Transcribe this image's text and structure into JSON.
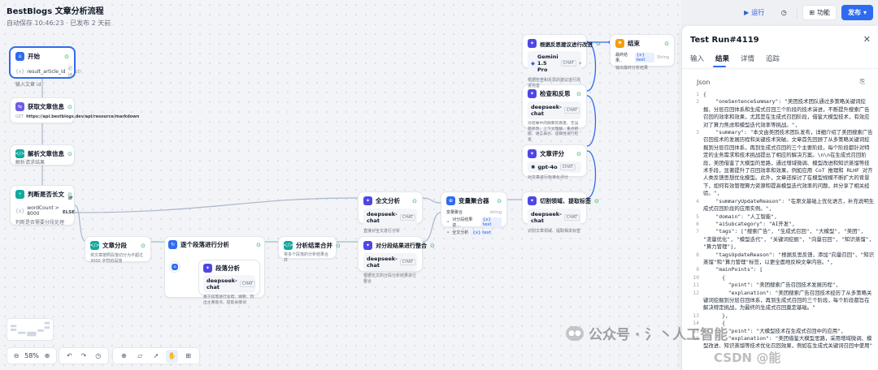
{
  "app": {
    "title": "BestBlogs 文章分析流程",
    "autosave": "自动保存 10:46:23 · 已发布 2 天前"
  },
  "toolbar": {
    "run_label": "运行",
    "feature_label": "功能",
    "publish_label": "发布"
  },
  "nodes": {
    "start": {
      "title": "开始",
      "var_name": "result_article_id",
      "var_badge": "必填",
      "var_type": "str",
      "desc": "输入文章 id"
    },
    "fetch": {
      "title": "获取文章信息",
      "method": "GET",
      "url": "https://api.bestblogs.dev/api/resource/markdown"
    },
    "parse": {
      "title": "解析文章信息",
      "desc": "解析请求结果"
    },
    "branch": {
      "title": "判断是否长文",
      "if_label": "IF",
      "condition": "wordCount > 8000",
      "else_label": "ELSE",
      "desc": "判断是否需要分段处理"
    },
    "split": {
      "title": "文章分段",
      "desc": "将文章按照段落切分为不超过 3000 字符的段落"
    },
    "iterate": {
      "title": "逐个段落进行分析"
    },
    "segment": {
      "title": "段落分析",
      "model": "deepseek-chat",
      "model_tag": "CHAT",
      "desc": "基于段落进行总结、摘要、列出主要观点、提取关键词"
    },
    "merge_result": {
      "title": "分析结果合并",
      "desc": "将多个段落的分析结果合并"
    },
    "full_analysis": {
      "title": "全文分析",
      "model": "deepseek-chat",
      "model_tag": "CHAT",
      "desc": "直接对全文进行分析"
    },
    "summarize": {
      "title": "对分段结果进行整合",
      "model": "deepseek-chat",
      "model_tag": "CHAT",
      "desc": "根据长文的分段分析结果进行整合"
    },
    "aggregate": {
      "title": "变量聚合器",
      "group_label": "变量聚合",
      "group_type": "string",
      "item1_label": "对分段结果进...",
      "item1_chip": "{x} text",
      "item2_label": "全文分析",
      "item2_chip": "{x} text"
    },
    "domain": {
      "title": "切割领域、提取标签",
      "model": "deepseek-chat",
      "model_tag": "CHAT",
      "desc": "识别文章领域、提取相关标签"
    },
    "score": {
      "title": "文章评分",
      "model": "gpt-4o",
      "model_tag": "CHAT",
      "desc": "对文章进行标准化评分"
    },
    "reflect": {
      "title": "检查和反思",
      "model": "deepseek-chat",
      "model_tag": "CHAT",
      "desc": "对结果中的摘要的质量、无误差修改、上下文理解、重点把握、语言表达、逻辑性进行检查"
    },
    "improve": {
      "title": "根据反思建议进行改进",
      "model": "Gemini 1.5 Pro",
      "model_tag": "CHAT",
      "desc": "根据检查和反思的建议进行改进完善"
    },
    "end": {
      "title": "结束",
      "var_label": "最终结果..",
      "var_chip": "{x} text",
      "var_type": "String",
      "desc": "输出最终分析结果"
    }
  },
  "panel": {
    "title": "Test Run#4119",
    "tabs": [
      "输入",
      "结果",
      "详情",
      "追踪"
    ],
    "active_tab": "结果",
    "section_label": "Json",
    "code_lines": [
      {
        "n": "1",
        "t": "{"
      },
      {
        "n": "2",
        "t": "    \"oneSentenceSummary\": \"美团技术团队通过多策略关键词挖掘、分层召回体系和生成式召回三个阶段的技术演进，不断提升搜索广告召回的效率和效果，尤其是在生成式召回阶段，借鉴大模型技术，有效应对了算力焦虑和模型迭代效率等挑战。\","
      },
      {
        "n": "3",
        "t": "    \"summary\": \"本文由美团技术团队发布，详细介绍了美团搜索广告召回技术的发展历程和关键技术突破。文章首先回顾了从多策略关键词挖掘到分层召回体系，再到生成式召回的三个主要阶段，每个阶段都针对特定的业务需求和技术挑战提出了相应的解决方案。\\n\\n在生成式召回阶段，美团借鉴了大模型的思路，通过增域微调、模型改进和知识蒸馏等技术手段，显著提升了召回效率和效果，例如应用 CoT 推理和 RLHF 对齐人类反馈思想优化模型。此外，文章还探讨了在模型规模不断扩大的背景下，如何有效管理算力资源和提高模型迭代效率的问题，并分享了相关经验。\","
      },
      {
        "n": "4",
        "t": "    \"summaryUpdateReason\": \"在原文基础上优化语言，补充说明生成式召回阶段的应用实例。\","
      },
      {
        "n": "5",
        "t": "    \"domain\": \"人工智能\","
      },
      {
        "n": "6",
        "t": "    \"aiSubcategory\": \"AI开发\","
      },
      {
        "n": "7",
        "t": "    \"tags\": [\"搜索广告\", \"生成式召回\", \"大模型\", \"美团\", \"流量优化\", \"模型迭代\", \"关键词挖掘\", \"向量召回\", \"知识蒸馏\", \"算力管理\"],"
      },
      {
        "n": "8",
        "t": "    \"tagsUpdateReason\": \"根据反思反馈，添加\"向量召回\"、\"知识蒸馏\"和\"算力管理\"标签，以更全面地反映文章内容。\","
      },
      {
        "n": "9",
        "t": "    \"mainPoints\": ["
      },
      {
        "n": "10",
        "t": "      {"
      },
      {
        "n": "11",
        "t": "        \"point\": \"美团搜索广告召回技术发展历程\","
      },
      {
        "n": "12",
        "t": "        \"explanation\": \"美团搜索广告召回技术经历了从多策略关键词挖掘到分层召回体系，再到生成式召回的三个阶段，每个阶段都旨在解决特定挑战，为最终的生成式召回奠定基础。\""
      },
      {
        "n": "13",
        "t": "      },"
      },
      {
        "n": "14",
        "t": "      {"
      },
      {
        "n": "15",
        "t": "        \"point\": \"大模型技术在生成式召回中的应用\","
      },
      {
        "n": "16",
        "t": "        \"explanation\": \"美团借鉴大模型思路，采用增域微调、模型改进、知识蒸馏等技术优化召回效果，例如在生成式关键词召回中使用\""
      }
    ]
  },
  "canvas": {
    "zoom": "58%"
  },
  "watermark": {
    "text": "公众号 · 氵丶人工智能",
    "corner": "CSDN @能"
  }
}
